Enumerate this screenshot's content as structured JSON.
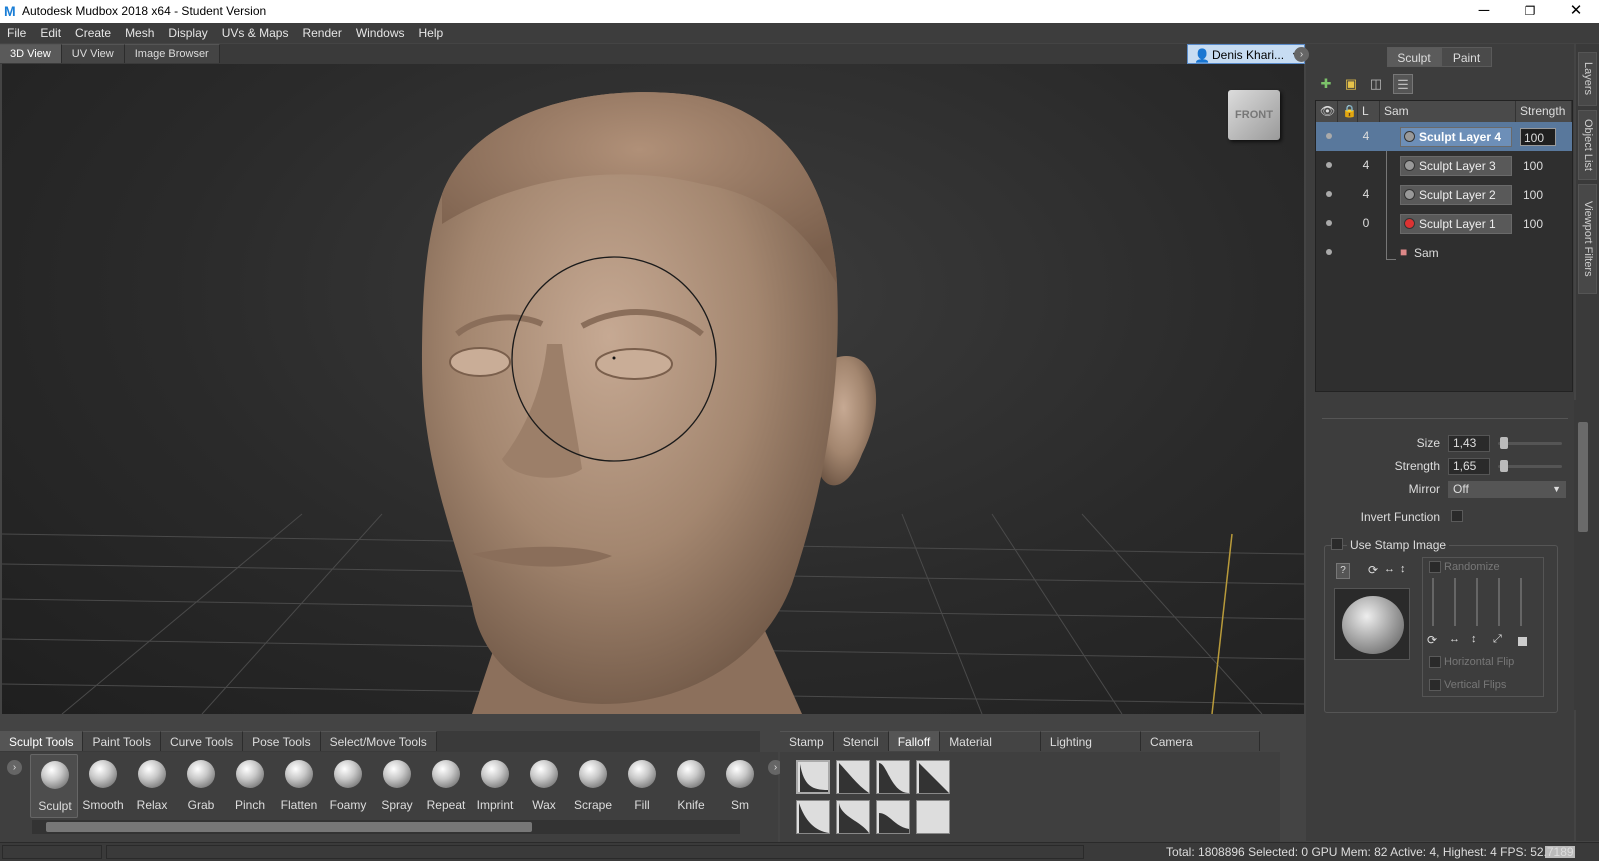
{
  "window": {
    "title": "Autodesk Mudbox 2018 x64 - Student Version",
    "logo": "M",
    "minimize": "─",
    "maximize": "❐",
    "close": "✕"
  },
  "menu": [
    "File",
    "Edit",
    "Create",
    "Mesh",
    "Display",
    "UVs & Maps",
    "Render",
    "Windows",
    "Help"
  ],
  "view_tabs": [
    {
      "label": "3D View",
      "active": true
    },
    {
      "label": "UV View",
      "active": false
    },
    {
      "label": "Image Browser",
      "active": false
    }
  ],
  "user": {
    "name": "Denis Khari...",
    "icon": "user-icon"
  },
  "viewcube": {
    "label": "FRONT"
  },
  "modes": {
    "sculpt": "Sculpt",
    "paint": "Paint"
  },
  "layers": {
    "headers": {
      "level": "L",
      "name": "Sam",
      "strength": "Strength"
    },
    "rows": [
      {
        "level": "4",
        "name": "Sculpt Layer 4",
        "strength": "100",
        "selected": true
      },
      {
        "level": "4",
        "name": "Sculpt Layer 3",
        "strength": "100",
        "selected": false
      },
      {
        "level": "4",
        "name": "Sculpt Layer 2",
        "strength": "100",
        "selected": false
      },
      {
        "level": "0",
        "name": "Sculpt Layer 1",
        "strength": "100",
        "selected": false
      }
    ],
    "root": "Sam"
  },
  "side_tabs": [
    "Layers",
    "Object List",
    "Viewport Filters"
  ],
  "props": {
    "size_label": "Size",
    "size_value": "1,43",
    "size_level": 0.03,
    "strength_label": "Strength",
    "strength_value": "1,65",
    "strength_level": 0.03,
    "mirror_label": "Mirror",
    "mirror_value": "Off",
    "invert_label": "Invert Function",
    "stamp_label": "Use Stamp Image",
    "randomize": "Randomize",
    "hflip": "Horizontal Flip",
    "vflip": "Vertical Flips"
  },
  "tool_tabs": [
    {
      "label": "Sculpt Tools",
      "active": true
    },
    {
      "label": "Paint Tools"
    },
    {
      "label": "Curve Tools"
    },
    {
      "label": "Pose Tools"
    },
    {
      "label": "Select/Move Tools"
    }
  ],
  "tools": [
    "Sculpt",
    "Smooth",
    "Relax",
    "Grab",
    "Pinch",
    "Flatten",
    "Foamy",
    "Spray",
    "Repeat",
    "Imprint",
    "Wax",
    "Scrape",
    "Fill",
    "Knife",
    "Sm"
  ],
  "right_tabs": [
    {
      "label": "Stamp"
    },
    {
      "label": "Stencil"
    },
    {
      "label": "Falloff",
      "active": true
    },
    {
      "label": "Material Presets"
    },
    {
      "label": "Lighting Presets"
    },
    {
      "label": "Camera Bookmarks"
    }
  ],
  "status": "Total: 1808896  Selected: 0 GPU Mem: 82  Active: 4, Highest: 4  FPS: 52.7189"
}
